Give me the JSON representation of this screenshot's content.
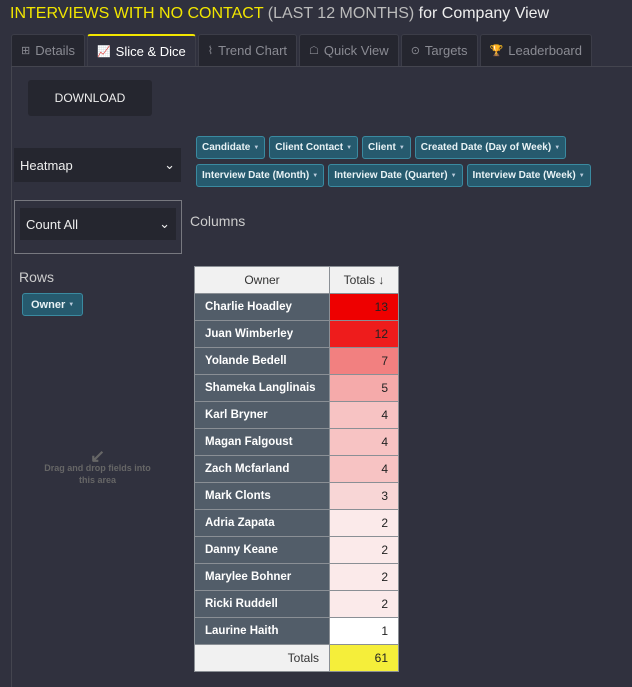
{
  "title": {
    "main": "INTERVIEWS WITH NO CONTACT",
    "period": "(LAST 12 MONTHS)",
    "suffix": "for Company View"
  },
  "tabs": [
    {
      "label": "Details",
      "icon": "table-icon"
    },
    {
      "label": "Slice & Dice",
      "icon": "chart-icon",
      "active": true
    },
    {
      "label": "Trend Chart",
      "icon": "line-chart-icon"
    },
    {
      "label": "Quick View",
      "icon": "sitemap-icon"
    },
    {
      "label": "Targets",
      "icon": "target-icon"
    },
    {
      "label": "Leaderboard",
      "icon": "trophy-icon"
    }
  ],
  "download_label": "DOWNLOAD",
  "renderer": "Heatmap",
  "aggregator": "Count All",
  "fields_row1": [
    "Candidate",
    "Client Contact",
    "Client",
    "Created Date (Day of Week)"
  ],
  "fields_row2": [
    "Interview Date (Month)",
    "Interview Date (Quarter)",
    "Interview Date (Week)"
  ],
  "columns_label": "Columns",
  "rows_label": "Rows",
  "row_field": "Owner",
  "drag_hint": "Drag and drop fields into this area",
  "table": {
    "header_owner": "Owner",
    "header_totals": "Totals ↓",
    "rows": [
      {
        "name": "Charlie Hoadley",
        "value": "13",
        "color": "#ee0000"
      },
      {
        "name": "Juan Wimberley",
        "value": "12",
        "color": "#ee1c1c"
      },
      {
        "name": "Yolande Bedell",
        "value": "7",
        "color": "#f28080"
      },
      {
        "name": "Shameka Langlinais",
        "value": "5",
        "color": "#f5aaaa"
      },
      {
        "name": "Karl Bryner",
        "value": "4",
        "color": "#f7c3c3"
      },
      {
        "name": "Magan Falgoust",
        "value": "4",
        "color": "#f7c3c3"
      },
      {
        "name": "Zach Mcfarland",
        "value": "4",
        "color": "#f7c3c3"
      },
      {
        "name": "Mark Clonts",
        "value": "3",
        "color": "#f8d6d6"
      },
      {
        "name": "Adria Zapata",
        "value": "2",
        "color": "#fbeaea"
      },
      {
        "name": "Danny Keane",
        "value": "2",
        "color": "#fbeaea"
      },
      {
        "name": "Marylee Bohner",
        "value": "2",
        "color": "#fbeaea"
      },
      {
        "name": "Ricki Ruddell",
        "value": "2",
        "color": "#fbeaea"
      },
      {
        "name": "Laurine Haith",
        "value": "1",
        "color": "#ffffff"
      }
    ],
    "totals_label": "Totals",
    "totals_value": "61"
  }
}
